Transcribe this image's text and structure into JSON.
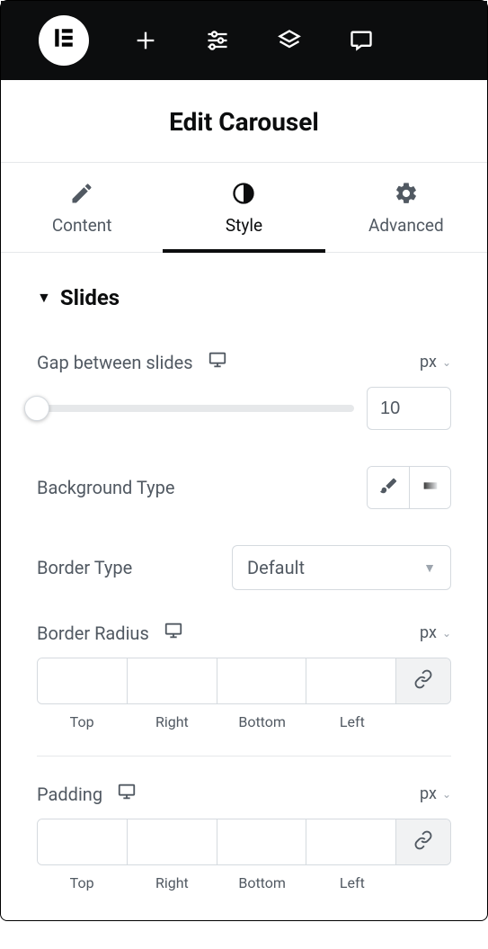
{
  "header": {
    "title": "Edit Carousel"
  },
  "tabs": [
    {
      "label": "Content"
    },
    {
      "label": "Style"
    },
    {
      "label": "Advanced"
    }
  ],
  "section": {
    "title": "Slides"
  },
  "gap": {
    "label": "Gap between slides",
    "unit": "px",
    "value": "10"
  },
  "bgType": {
    "label": "Background Type"
  },
  "borderType": {
    "label": "Border Type",
    "value": "Default"
  },
  "borderRadius": {
    "label": "Border Radius",
    "unit": "px",
    "sides": {
      "top": "Top",
      "right": "Right",
      "bottom": "Bottom",
      "left": "Left"
    }
  },
  "padding": {
    "label": "Padding",
    "unit": "px",
    "sides": {
      "top": "Top",
      "right": "Right",
      "bottom": "Bottom",
      "left": "Left"
    }
  }
}
